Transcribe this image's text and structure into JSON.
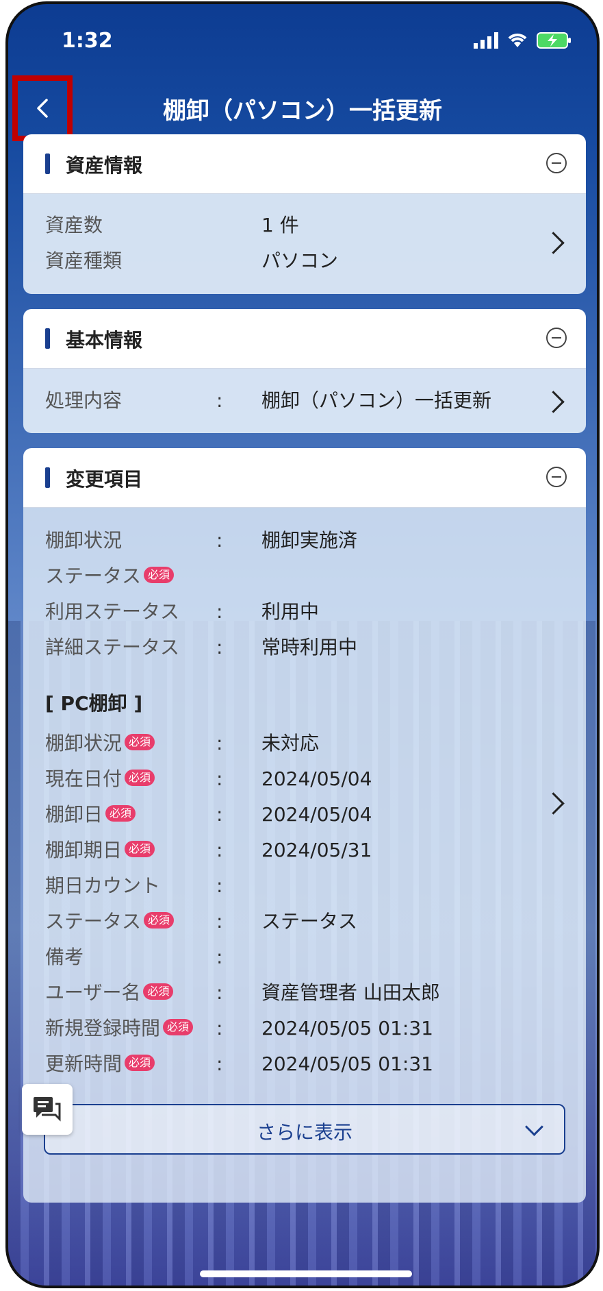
{
  "status_bar": {
    "time": "1:32"
  },
  "header": {
    "title": "棚卸（パソコン）一括更新"
  },
  "asset_info": {
    "title": "資産情報",
    "rows": [
      {
        "label": "資産数",
        "value": "1 件"
      },
      {
        "label": "資産種類",
        "value": "パソコン"
      }
    ]
  },
  "basic_info": {
    "title": "基本情報",
    "rows": [
      {
        "label": "処理内容",
        "colon": ":",
        "value": "棚卸（パソコン）一括更新"
      }
    ]
  },
  "change_items": {
    "title": "変更項目",
    "required_badge": "必須",
    "rows": [
      {
        "label": "棚卸状況",
        "colon": ":",
        "value": "棚卸実施済"
      },
      {
        "label": "ステータス",
        "required": true
      },
      {
        "label": "利用ステータス",
        "colon": ":",
        "value": "利用中"
      },
      {
        "label": "詳細ステータス",
        "colon": ":",
        "value": "常時利用中"
      }
    ],
    "pc_section_label": "[ PC棚卸 ]",
    "pc_rows": [
      {
        "label": "棚卸状況",
        "required": true,
        "colon": ":",
        "value": "未対応"
      },
      {
        "label": "現在日付",
        "required": true,
        "colon": ":",
        "value": "2024/05/04"
      },
      {
        "label": "棚卸日",
        "required": true,
        "colon": ":",
        "value": "2024/05/04"
      },
      {
        "label": "棚卸期日",
        "required": true,
        "colon": ":",
        "value": "2024/05/31"
      },
      {
        "label": "期日カウント",
        "colon": ":",
        "value": ""
      },
      {
        "label": "ステータス",
        "required": true,
        "colon": ":",
        "value": "ステータス"
      },
      {
        "label": "備考",
        "colon": ":",
        "value": ""
      },
      {
        "label": "ユーザー名",
        "required": true,
        "colon": ":",
        "value": "資産管理者 山田太郎"
      },
      {
        "label": "新規登録時間",
        "required": true,
        "colon": ":",
        "value": "2024/05/05 01:31"
      },
      {
        "label": "更新時間",
        "required": true,
        "colon": ":",
        "value": "2024/05/05 01:31"
      }
    ],
    "more_label": "さらに表示"
  },
  "icons": {
    "back": "chevron-left-icon",
    "collapse": "minus-circle-icon",
    "row_chevron": "chevron-right-icon",
    "more_chevron": "chevron-down-icon",
    "chat": "chat-icon"
  },
  "colors": {
    "header": "#0d3c92",
    "accent": "#1a3f8f",
    "required": "#e83d6b",
    "highlight": "#c00000"
  }
}
